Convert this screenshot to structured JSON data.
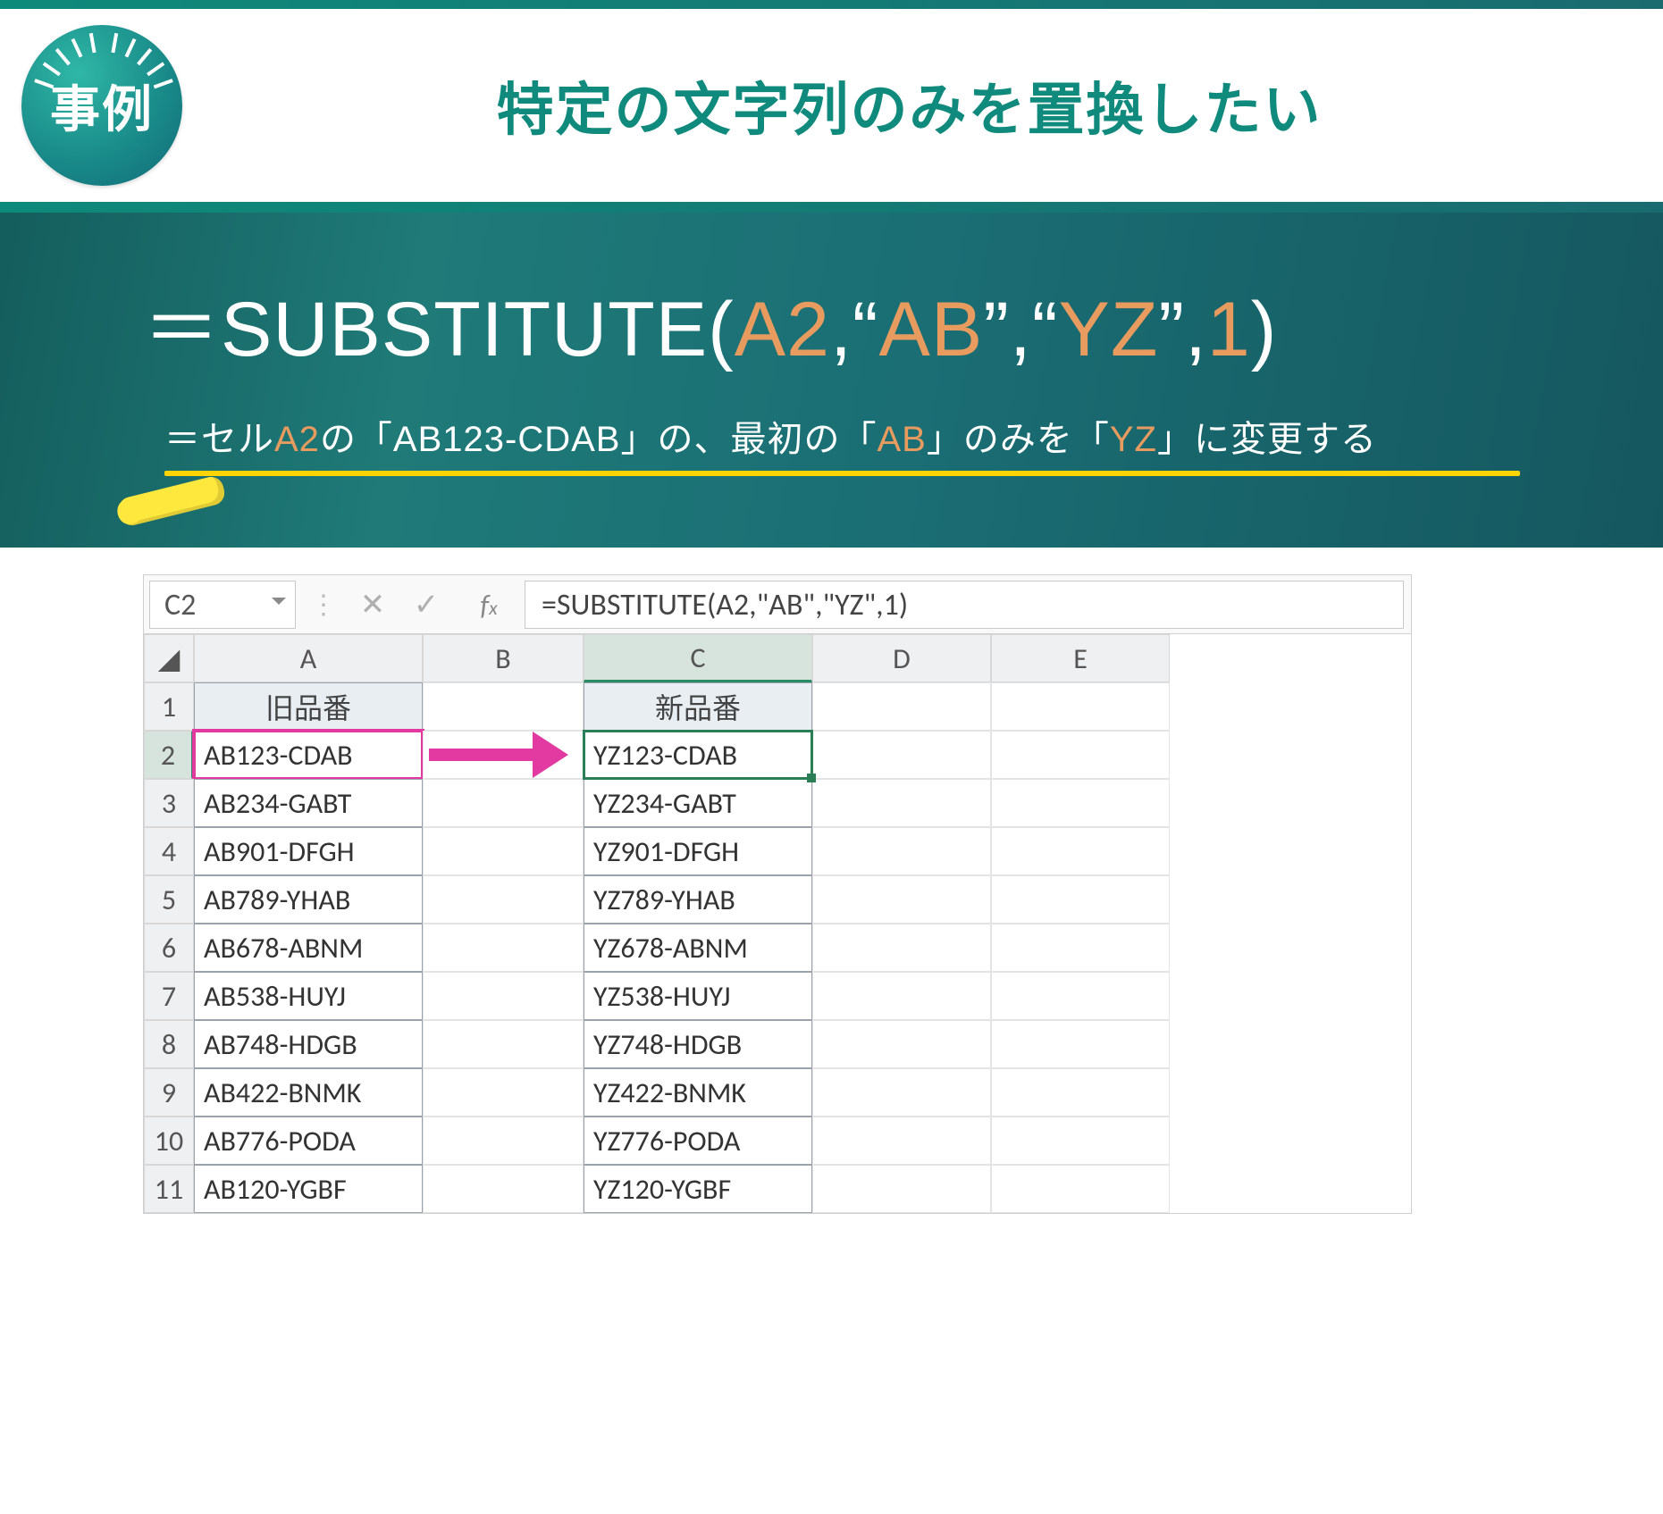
{
  "header": {
    "badge": "事例",
    "title": "特定の文字列のみを置換したい"
  },
  "formula": {
    "prefix": "＝SUBSTITUTE",
    "open": "(",
    "ref": "A2",
    "sep1": ",",
    "q1l": "“",
    "lit1": "AB",
    "q1r": "”",
    "sep2": ",",
    "q2l": "“",
    "lit2": "YZ",
    "q2r": "”",
    "sep3": ",",
    "num": "1",
    "close": ")"
  },
  "description": {
    "p1": "＝セル",
    "ref": "A2",
    "p2": "の「AB123-CDAB」の、最初の「",
    "lit1": "AB",
    "p3": "」のみを「",
    "lit2": "YZ",
    "p4": "」に変更する"
  },
  "sheet": {
    "name_box": "C2",
    "fx": "=SUBSTITUTE(A2,\"AB\",\"YZ\",1)",
    "columns": [
      "A",
      "B",
      "C",
      "D",
      "E"
    ],
    "headers": {
      "a": "旧品番",
      "c": "新品番"
    },
    "rows": [
      {
        "n": "1"
      },
      {
        "n": "2",
        "a": "AB123-CDAB",
        "c": "YZ123-CDAB"
      },
      {
        "n": "3",
        "a": "AB234-GABT",
        "c": "YZ234-GABT"
      },
      {
        "n": "4",
        "a": "AB901-DFGH",
        "c": "YZ901-DFGH"
      },
      {
        "n": "5",
        "a": "AB789-YHAB",
        "c": "YZ789-YHAB"
      },
      {
        "n": "6",
        "a": "AB678-ABNM",
        "c": "YZ678-ABNM"
      },
      {
        "n": "7",
        "a": "AB538-HUYJ",
        "c": "YZ538-HUYJ"
      },
      {
        "n": "8",
        "a": "AB748-HDGB",
        "c": "YZ748-HDGB"
      },
      {
        "n": "9",
        "a": "AB422-BNMK",
        "c": "YZ422-BNMK"
      },
      {
        "n": "10",
        "a": "AB776-PODA",
        "c": "YZ776-PODA"
      },
      {
        "n": "11",
        "a": "AB120-YGBF",
        "c": "YZ120-YGBF"
      }
    ]
  }
}
